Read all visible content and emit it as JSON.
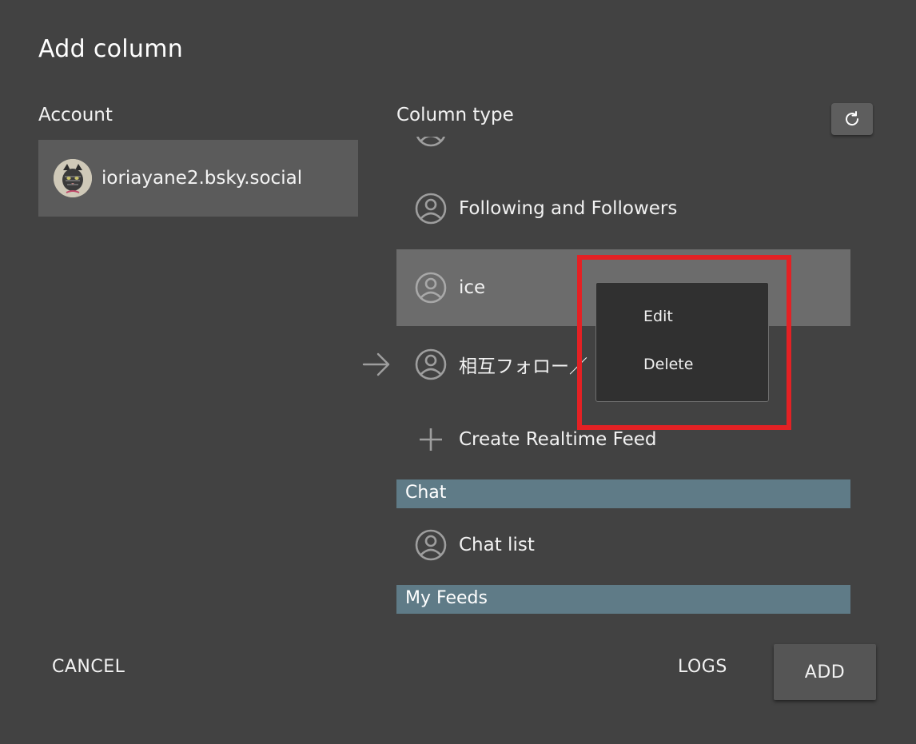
{
  "dialog": {
    "title": "Add column"
  },
  "account": {
    "section_label": "Account",
    "handle": "ioriayane2.bsky.social",
    "avatar_icon": "cat-avatar"
  },
  "column_type": {
    "section_label": "Column type",
    "refresh_icon": "refresh-icon",
    "items": [
      {
        "label": "Following and Followers",
        "icon": "person-circle-icon"
      },
      {
        "label": "ice",
        "icon": "person-circle-icon",
        "selected": true
      },
      {
        "label": "相互フォロー／",
        "icon": "person-circle-icon"
      },
      {
        "label": "Create Realtime Feed",
        "icon": "plus-icon"
      }
    ],
    "sections": [
      {
        "label": "Chat",
        "items": [
          {
            "label": "Chat list",
            "icon": "person-circle-icon"
          }
        ]
      },
      {
        "label": "My Feeds",
        "items": []
      }
    ]
  },
  "context_menu": {
    "edit_label": "Edit",
    "delete_label": "Delete"
  },
  "footer": {
    "cancel_label": "CANCEL",
    "logs_label": "LOGS",
    "add_label": "ADD"
  },
  "colors": {
    "background": "#424242",
    "selected_row": "#6c6c6c",
    "section_header": "#5f7b87",
    "highlight": "#e32124"
  }
}
